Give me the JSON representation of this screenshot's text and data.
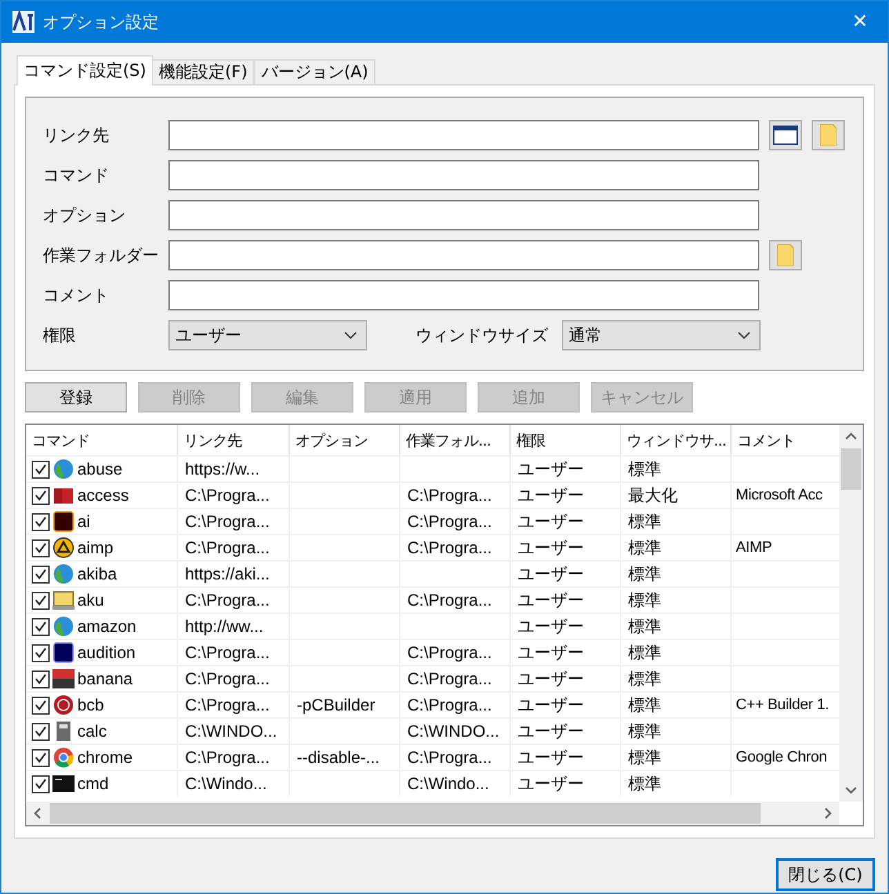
{
  "window": {
    "title": "オプション設定",
    "close": "✕"
  },
  "tabs": [
    {
      "label": "コマンド設定(S)",
      "selected": true
    },
    {
      "label": "機能設定(F)",
      "selected": false
    },
    {
      "label": "バージョン(A)",
      "selected": false
    }
  ],
  "form": {
    "fields": [
      {
        "label": "リンク先",
        "window_button": true,
        "folder_button": true
      },
      {
        "label": "コマンド"
      },
      {
        "label": "オプション"
      },
      {
        "label": "作業フォルダー",
        "folder_button": true
      },
      {
        "label": "コメント"
      }
    ],
    "permission": {
      "label": "権限",
      "value": "ユーザー"
    },
    "window_size": {
      "label": "ウィンドウサイズ",
      "value": "通常"
    }
  },
  "actions": [
    {
      "label": "登録",
      "disabled": false
    },
    {
      "label": "削除",
      "disabled": true
    },
    {
      "label": "編集",
      "disabled": true
    },
    {
      "label": "適用",
      "disabled": true
    },
    {
      "label": "追加",
      "disabled": true
    },
    {
      "label": "キャンセル",
      "disabled": true
    }
  ],
  "table": {
    "columns": [
      "コマンド",
      "リンク先",
      "オプション",
      "作業フォル...",
      "権限",
      "ウィンドウサ...",
      "コメント"
    ],
    "rows": [
      {
        "checked": true,
        "cells": [
          "abuse",
          "https://w...",
          "",
          "",
          "ユーザー",
          "標準",
          ""
        ]
      },
      {
        "checked": true,
        "cells": [
          "access",
          "C:\\Progra...",
          "",
          "C:\\Progra...",
          "ユーザー",
          "最大化",
          "Microsoft Acc"
        ]
      },
      {
        "checked": true,
        "cells": [
          "ai",
          "C:\\Progra...",
          "",
          "C:\\Progra...",
          "ユーザー",
          "標準",
          ""
        ]
      },
      {
        "checked": true,
        "cells": [
          "aimp",
          "C:\\Progra...",
          "",
          "C:\\Progra...",
          "ユーザー",
          "標準",
          "AIMP"
        ]
      },
      {
        "checked": true,
        "cells": [
          "akiba",
          "https://aki...",
          "",
          "",
          "ユーザー",
          "標準",
          ""
        ]
      },
      {
        "checked": true,
        "cells": [
          "aku",
          "C:\\Progra...",
          "",
          "C:\\Progra...",
          "ユーザー",
          "標準",
          ""
        ]
      },
      {
        "checked": true,
        "cells": [
          "amazon",
          "http://ww...",
          "",
          "",
          "ユーザー",
          "標準",
          ""
        ]
      },
      {
        "checked": true,
        "cells": [
          "audition",
          "C:\\Progra...",
          "",
          "C:\\Progra...",
          "ユーザー",
          "標準",
          ""
        ]
      },
      {
        "checked": true,
        "cells": [
          "banana",
          "C:\\Progra...",
          "",
          "C:\\Progra...",
          "ユーザー",
          "標準",
          ""
        ]
      },
      {
        "checked": true,
        "cells": [
          "bcb",
          "C:\\Progra...",
          "-pCBuilder",
          "C:\\Progra...",
          "ユーザー",
          "標準",
          "C++ Builder 1."
        ]
      },
      {
        "checked": true,
        "cells": [
          "calc",
          "C:\\WINDO...",
          "",
          "C:\\WINDO...",
          "ユーザー",
          "標準",
          ""
        ]
      },
      {
        "checked": true,
        "cells": [
          "chrome",
          "C:\\Progra...",
          "--disable-...",
          "C:\\Progra...",
          "ユーザー",
          "標準",
          "Google Chron"
        ]
      },
      {
        "checked": true,
        "cells": [
          "cmd",
          "C:\\Windo...",
          "",
          "C:\\Windo...",
          "ユーザー",
          "標準",
          ""
        ]
      }
    ]
  },
  "footer": {
    "close_button": "閉じる(C)"
  }
}
